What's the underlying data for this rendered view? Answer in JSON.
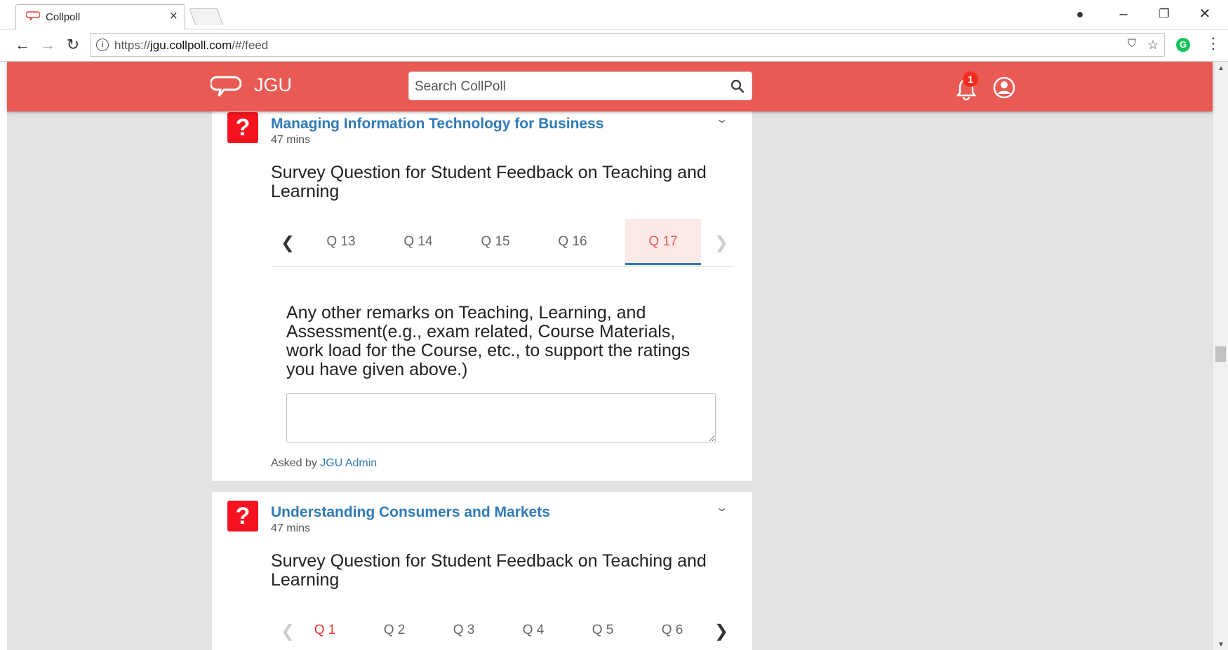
{
  "browser": {
    "tab_title": "Collpoll",
    "url_prefix": "https://",
    "url_host": "jgu.collpoll.com",
    "url_path": "/#/feed"
  },
  "header": {
    "brand": "JGU",
    "search_placeholder": "Search CollPoll",
    "notification_count": "1",
    "accent_color": "#e85a53"
  },
  "cards": [
    {
      "title": "Managing Information Technology for Business",
      "time": "47 mins",
      "subtitle": "Survey Question for Student Feedback on Teaching and Learning",
      "tabs": [
        "Q 13",
        "Q 14",
        "Q 15",
        "Q 16",
        "Q 17"
      ],
      "active_tab": "Q 17",
      "question": "Any other remarks on Teaching, Learning, and Assessment(e.g., exam related, Course Materials, work load for the Course, etc., to support the ratings you have given above.)",
      "answer_value": "",
      "asked_by_label": "Asked by",
      "asked_by_name": "JGU Admin"
    },
    {
      "title": "Understanding Consumers and Markets",
      "time": "47 mins",
      "subtitle": "Survey Question for Student Feedback on Teaching and Learning",
      "tabs": [
        "Q 1",
        "Q 2",
        "Q 3",
        "Q 4",
        "Q 5",
        "Q 6"
      ],
      "active_tab": "Q 1"
    }
  ]
}
